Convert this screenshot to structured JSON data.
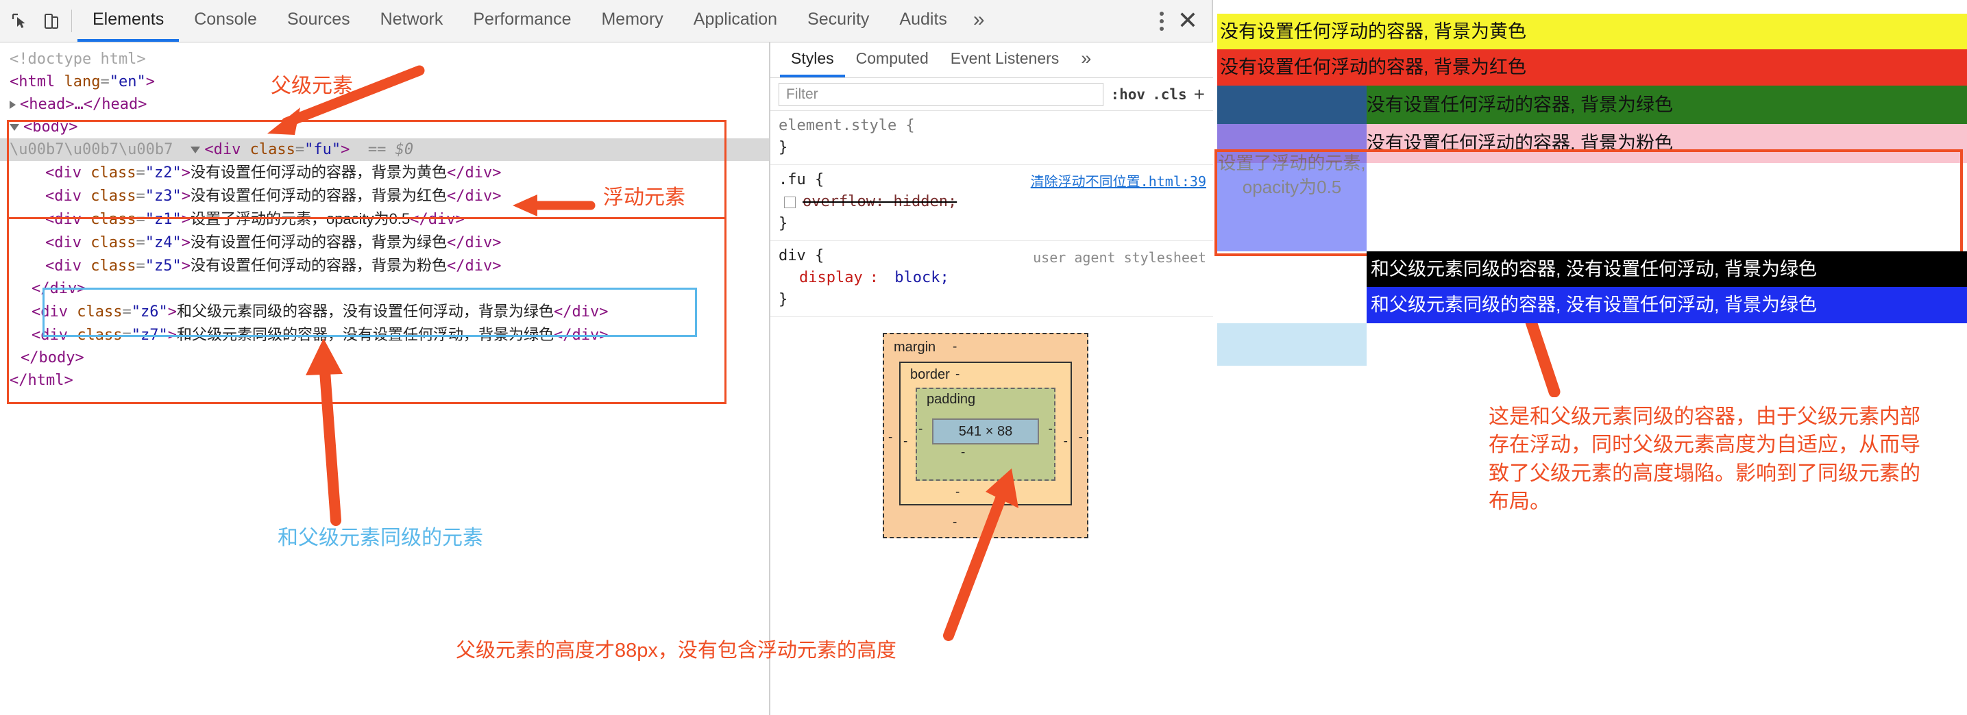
{
  "devtools": {
    "toolbar": {
      "inspect_icon": "inspect-cursor-icon",
      "device_icon": "device-toolbar-icon",
      "tabs": [
        {
          "label": "Elements",
          "active": true
        },
        {
          "label": "Console",
          "active": false
        },
        {
          "label": "Sources",
          "active": false
        },
        {
          "label": "Network",
          "active": false
        },
        {
          "label": "Performance",
          "active": false
        },
        {
          "label": "Memory",
          "active": false
        },
        {
          "label": "Application",
          "active": false
        },
        {
          "label": "Security",
          "active": false
        },
        {
          "label": "Audits",
          "active": false
        }
      ],
      "more_tabs": "»",
      "menu_icon": "kebab-menu-icon",
      "close_label": "✕"
    },
    "dom": {
      "doctype": "<!doctype html>",
      "html_open_tag": "<html",
      "html_attr_name": "lang",
      "html_attr_value": "\"en\"",
      "head_line": "<head>…</head>",
      "body_open": "<body>",
      "selected_node": {
        "tag": "div",
        "attr": "class",
        "value": "\"fu\"",
        "marker": "== $0"
      },
      "children": [
        {
          "class": "\"z2\"",
          "text": "没有设置任何浮动的容器，背景为黄色"
        },
        {
          "class": "\"z3\"",
          "text": "没有设置任何浮动的容器，背景为红色"
        },
        {
          "class": "\"z1\"",
          "text": "设置了浮动的元素，opacity为0.5"
        },
        {
          "class": "\"z4\"",
          "text": "没有设置任何浮动的容器，背景为绿色"
        },
        {
          "class": "\"z5\"",
          "text": "没有设置任何浮动的容器，背景为粉色"
        }
      ],
      "close_fu": "</div>",
      "siblings": [
        {
          "class": "\"z6\"",
          "text": "和父级元素同级的容器，没有设置任何浮动，背景为绿色"
        },
        {
          "class": "\"z7\"",
          "text": "和父级元素同级的容器，没有设置任何浮动，背景为绿色"
        }
      ],
      "close_body": "</body>",
      "close_html": "</html>"
    },
    "styles": {
      "tabs": [
        {
          "label": "Styles",
          "active": true
        },
        {
          "label": "Computed",
          "active": false
        },
        {
          "label": "Event Listeners",
          "active": false
        }
      ],
      "more_tabs": "»",
      "filter_placeholder": "Filter",
      "hov_label": ":hov",
      "cls_label": ".cls",
      "plus_label": "+",
      "element_style": {
        "selector": "element.style {",
        "close": "}"
      },
      "fu_rule": {
        "selector": ".fu {",
        "origin": "清除浮动不同位置.html:39",
        "prop": "overflow",
        "value": "hidden;",
        "close": "}"
      },
      "div_rule": {
        "selector": "div {",
        "origin": "user agent stylesheet",
        "prop": "display",
        "value": "block;",
        "close": "}"
      }
    },
    "box_model": {
      "margin_label": "margin",
      "border_label": "border",
      "padding_label": "padding",
      "content_label": "541 × 88",
      "dash": "-"
    }
  },
  "annotations": {
    "parent_element": "父级元素",
    "float_element": "浮动元素",
    "sibling_element": "和父级元素同级的元素",
    "height_note": "父级元素的高度才88px，没有包含浮动元素的高度",
    "collapse_note": "这是和父级元素同级的容器，由于父级元素内部存在浮动，同时父级元素高度为自适应，从而导致了父级元素的高度塌陷。影响到了同级元素的布局。"
  },
  "preview": {
    "rows": [
      {
        "name": "z2",
        "text": "没有设置任何浮动的容器, 背景为黄色",
        "color": "#f7f52e"
      },
      {
        "name": "z3",
        "text": "没有设置任何浮动的容器, 背景为红色",
        "color": "#ea3323"
      },
      {
        "name": "z4",
        "text": "没有设置任何浮动的容器, 背景为绿色",
        "color": "#2a7a1e"
      },
      {
        "name": "z5",
        "text": "没有设置任何浮动的容器, 背景为粉色",
        "color": "#f9c4cf"
      },
      {
        "name": "z6",
        "text": "和父级元素同级的容器, 没有设置任何浮动, 背景为绿色",
        "color": "#000000"
      },
      {
        "name": "z7",
        "text": "和父级元素同级的容器, 没有设置任何浮动, 背景为绿色",
        "color": "#1d2ef0"
      }
    ],
    "float_box": {
      "name": "z1",
      "text": "设置了浮动的元素, opacity为0.5",
      "color": "#2a39f5",
      "opacity": "0.5"
    }
  }
}
